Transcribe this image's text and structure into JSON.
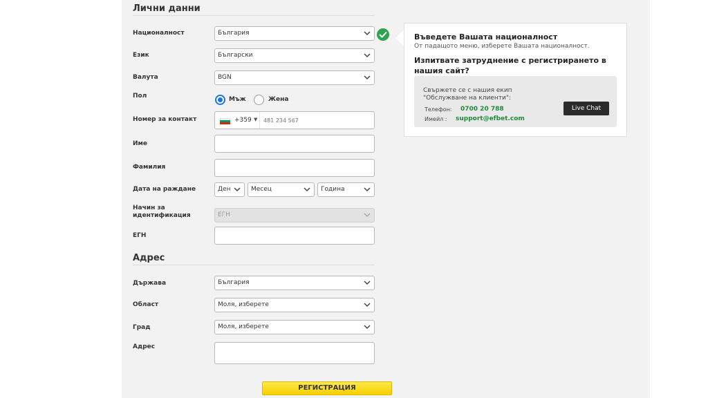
{
  "personal": {
    "title": "Лични данни",
    "nationality_label": "Националност",
    "nationality_value": "България",
    "language_label": "Език",
    "language_value": "Български",
    "currency_label": "Валута",
    "currency_value": "BGN",
    "gender_label": "Пол",
    "gender_male": "Мъж",
    "gender_female": "Жена",
    "gender_selected": "Мъж",
    "phone_label": "Номер за контакт",
    "phone_code": "+359",
    "phone_placeholder": "481 234 567",
    "first_name_label": "Име",
    "last_name_label": "Фамилия",
    "birth_label": "Дата на раждане",
    "birth_day": "Ден",
    "birth_month": "Месец",
    "birth_year": "Година",
    "id_method_label": "Начин за идентификация",
    "id_method_value": "ЕГН",
    "egn_label": "ЕГН"
  },
  "address": {
    "title": "Адрес",
    "country_label": "Държава",
    "country_value": "България",
    "region_label": "Област",
    "region_value": "Моля, изберете",
    "city_label": "Град",
    "city_value": "Моля, изберете",
    "address_label": "Адрес"
  },
  "tooltip": {
    "title": "Въведете Вашата националност",
    "subtitle": "От падащото меню, изберете Вашата националност.",
    "question": "Изпитвате затруднение с регистрирането в нашия сайт?",
    "contact_line1": "Свържете се с нашия екип",
    "contact_line2": "\"Обслужване на клиенти\":",
    "phone_key": "Телефон:",
    "phone_value": "0700 20 788",
    "email_key": "Имейл :",
    "email_value": "support@efbet.com",
    "live_chat": "Live Chat"
  },
  "register_button": "РЕГИСТРАЦИЯ",
  "colors": {
    "accent_yellow": "#f5cf00",
    "radio_blue": "#1a73e8",
    "success_green": "#2ea44f",
    "link_green": "#1e8a3a"
  }
}
